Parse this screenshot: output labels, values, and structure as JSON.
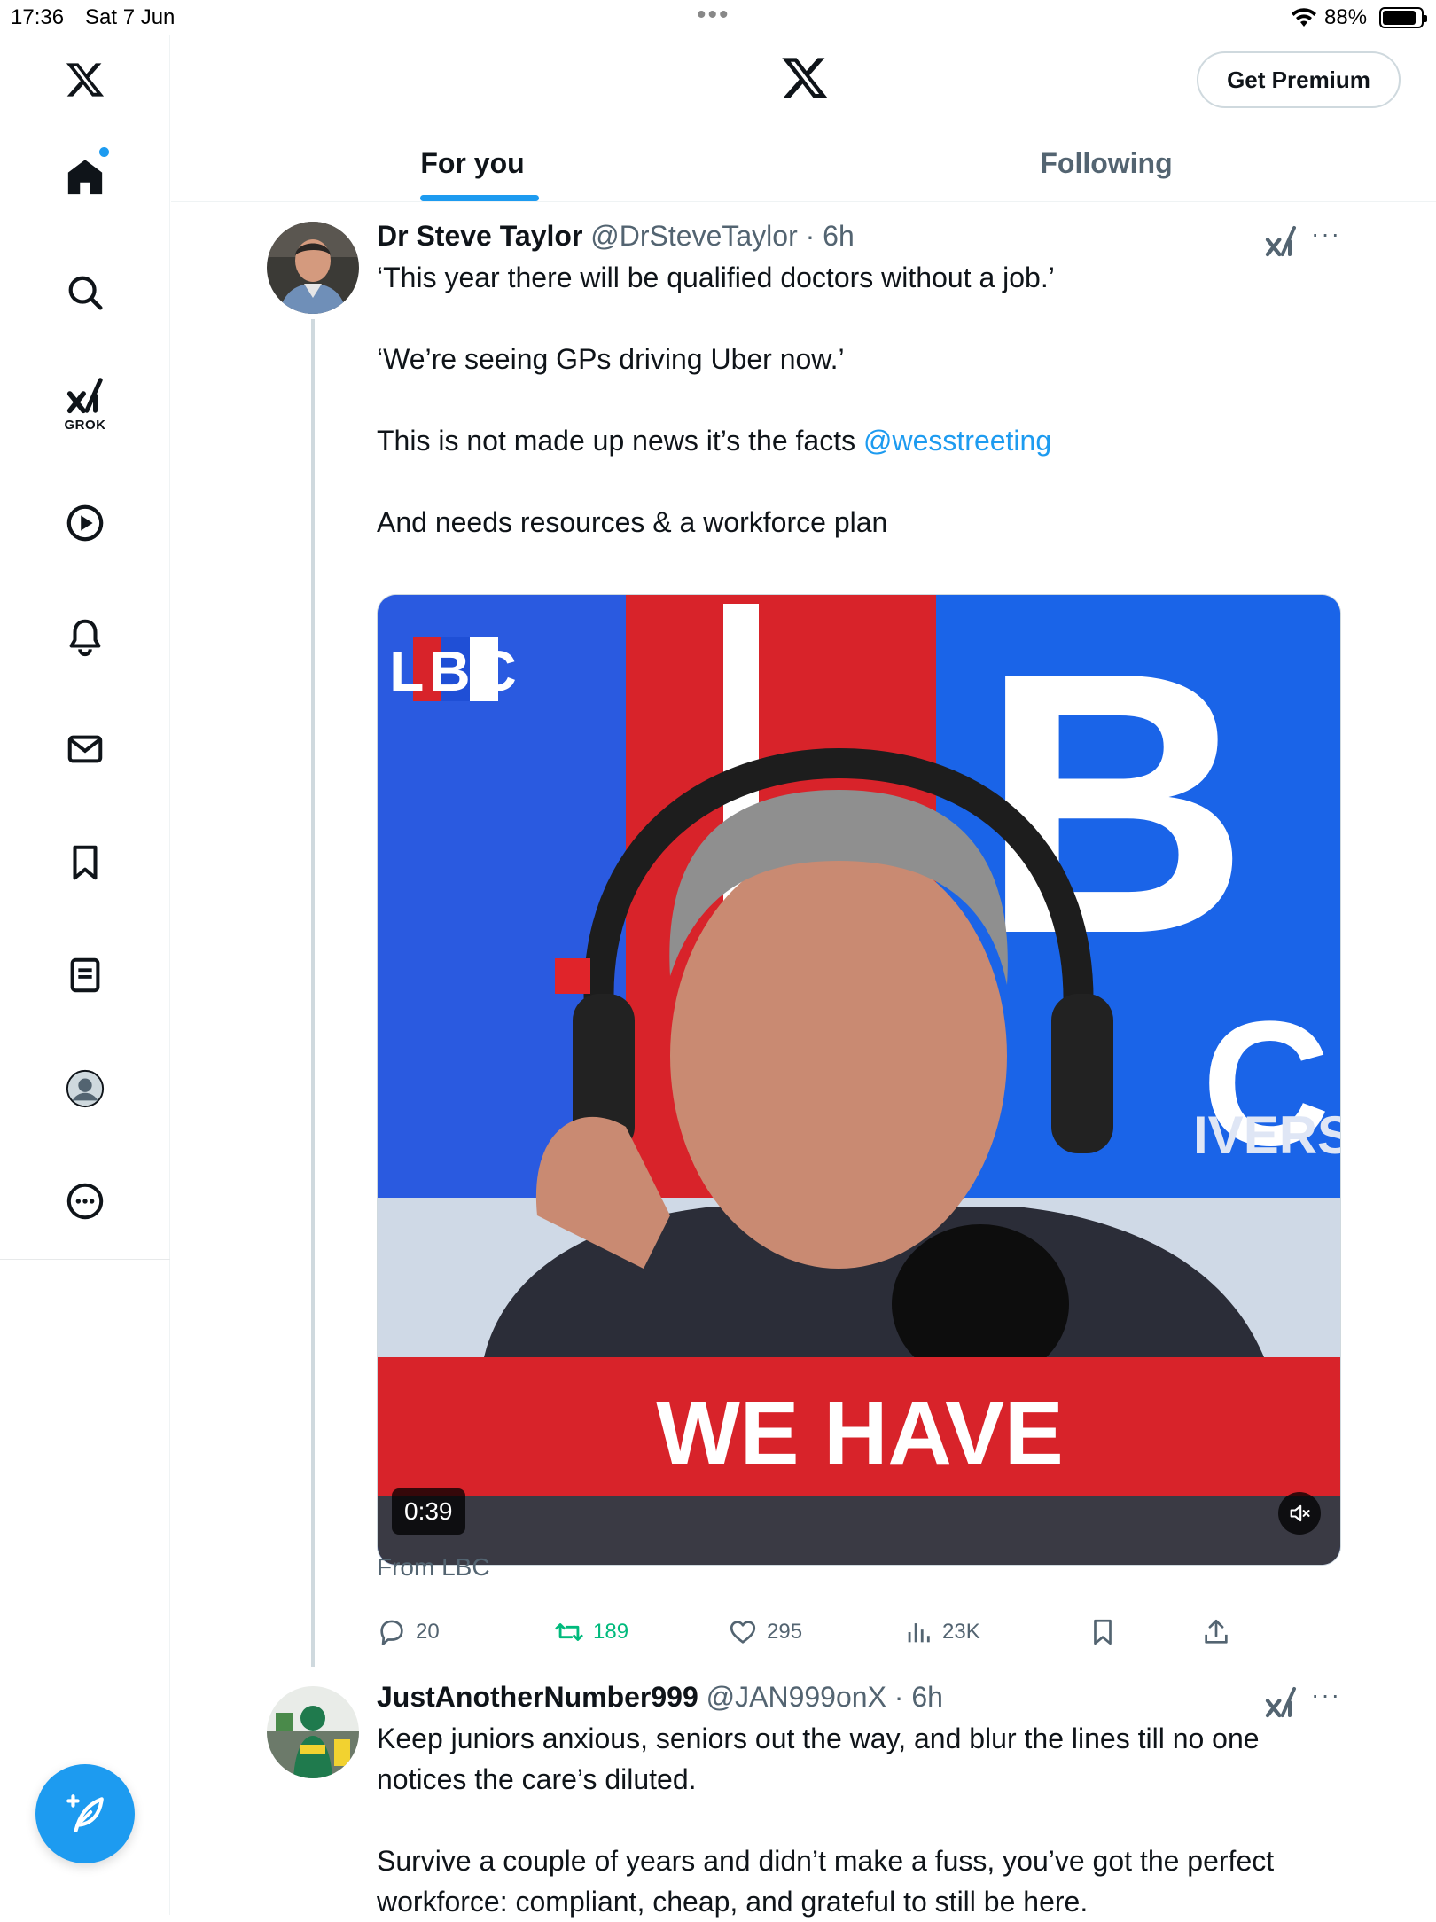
{
  "status_bar": {
    "time": "17:36",
    "date": "Sat 7 Jun",
    "battery": "88%",
    "battery_level": 0.88
  },
  "sidebar": {
    "logo": "x-logo-icon",
    "items": [
      {
        "name": "home",
        "icon": "home-icon"
      },
      {
        "name": "search",
        "icon": "search-icon"
      },
      {
        "name": "grok",
        "icon": "grok-icon",
        "label": "GROK"
      },
      {
        "name": "video",
        "icon": "play-icon"
      },
      {
        "name": "notifications",
        "icon": "bell-icon"
      },
      {
        "name": "messages",
        "icon": "envelope-icon"
      },
      {
        "name": "bookmarks",
        "icon": "bookmark-icon"
      },
      {
        "name": "lists",
        "icon": "list-icon"
      },
      {
        "name": "profile",
        "icon": "profile-icon"
      },
      {
        "name": "more",
        "icon": "more-icon"
      }
    ],
    "compose_icon": "compose-icon"
  },
  "header": {
    "premium_label": "Get Premium",
    "tabs": [
      {
        "label": "For you",
        "active": true
      },
      {
        "label": "Following",
        "active": false
      }
    ]
  },
  "tweets": [
    {
      "name": "Dr Steve Taylor",
      "handle": "@DrSteveTaylor",
      "time": "6h",
      "paragraphs": [
        "‘This year there will be qualified doctors without a job.’",
        "",
        "‘We’re seeing GPs driving Uber now.’",
        "",
        "This is not made up news it’s the facts ",
        "",
        "And needs resources & a workforce plan"
      ],
      "mention": "@wesstreeting",
      "media": {
        "logo_text": "LBC",
        "caption": "WE HAVE",
        "backdrop_text": "IVERS",
        "duration": "0:39"
      },
      "source": "From LBC",
      "stats": {
        "replies": "20",
        "retweets": "189",
        "likes": "295",
        "views": "23K"
      }
    },
    {
      "name": "JustAnotherNumber999",
      "handle": "@JAN999onX",
      "time": "6h",
      "paragraphs": [
        "Keep juniors anxious, seniors out the way, and blur the lines till no one notices the care’s diluted.",
        "",
        "Survive a couple of years and didn’t make a fuss, you’ve got the perfect workforce: compliant, cheap, and grateful to still be here."
      ]
    }
  ],
  "colors": {
    "accent": "#1d9bf0",
    "text": "#0f1419",
    "muted": "#536471",
    "retweet_green": "#00ba7c",
    "lbc_red": "#d8232a",
    "lbc_blue": "#1f4fd6"
  }
}
